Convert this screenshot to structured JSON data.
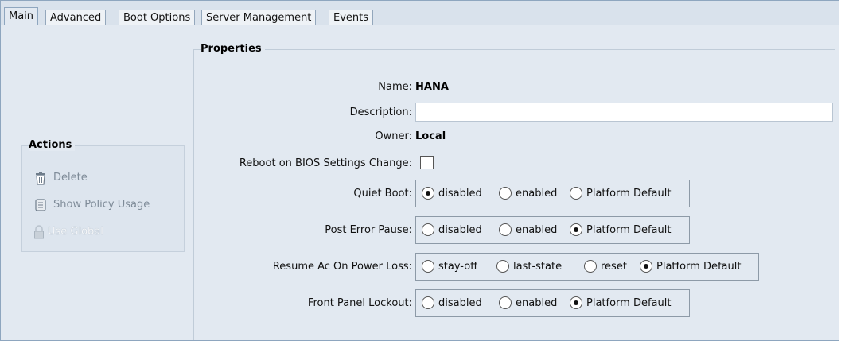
{
  "tabs": [
    "Main",
    "Advanced",
    "Boot Options",
    "Server Management",
    "Events"
  ],
  "actions": {
    "title": "Actions",
    "items": [
      {
        "label": "Delete",
        "icon": "trash-icon",
        "enabled": true
      },
      {
        "label": "Show Policy Usage",
        "icon": "policy-scroll-icon",
        "enabled": true
      },
      {
        "label": "Use Global",
        "icon": "lock-icon",
        "enabled": false
      }
    ]
  },
  "properties": {
    "title": "Properties",
    "name_label": "Name:",
    "name_value": "HANA",
    "description_label": "Description:",
    "description_value": "",
    "owner_label": "Owner:",
    "owner_value": "Local",
    "reboot_label": "Reboot on BIOS Settings Change:",
    "reboot_checked": false,
    "quiet_boot": {
      "label": "Quiet Boot:",
      "options": [
        "disabled",
        "enabled",
        "Platform Default"
      ],
      "selected": "disabled"
    },
    "post_error_pause": {
      "label": "Post Error Pause:",
      "options": [
        "disabled",
        "enabled",
        "Platform Default"
      ],
      "selected": "Platform Default"
    },
    "resume_ac": {
      "label": "Resume Ac On Power Loss:",
      "options": [
        "stay-off",
        "last-state",
        "reset",
        "Platform Default"
      ],
      "selected": "Platform Default"
    },
    "front_panel_lockout": {
      "label": "Front Panel Lockout:",
      "options": [
        "disabled",
        "enabled",
        "Platform Default"
      ],
      "selected": "Platform Default"
    }
  }
}
